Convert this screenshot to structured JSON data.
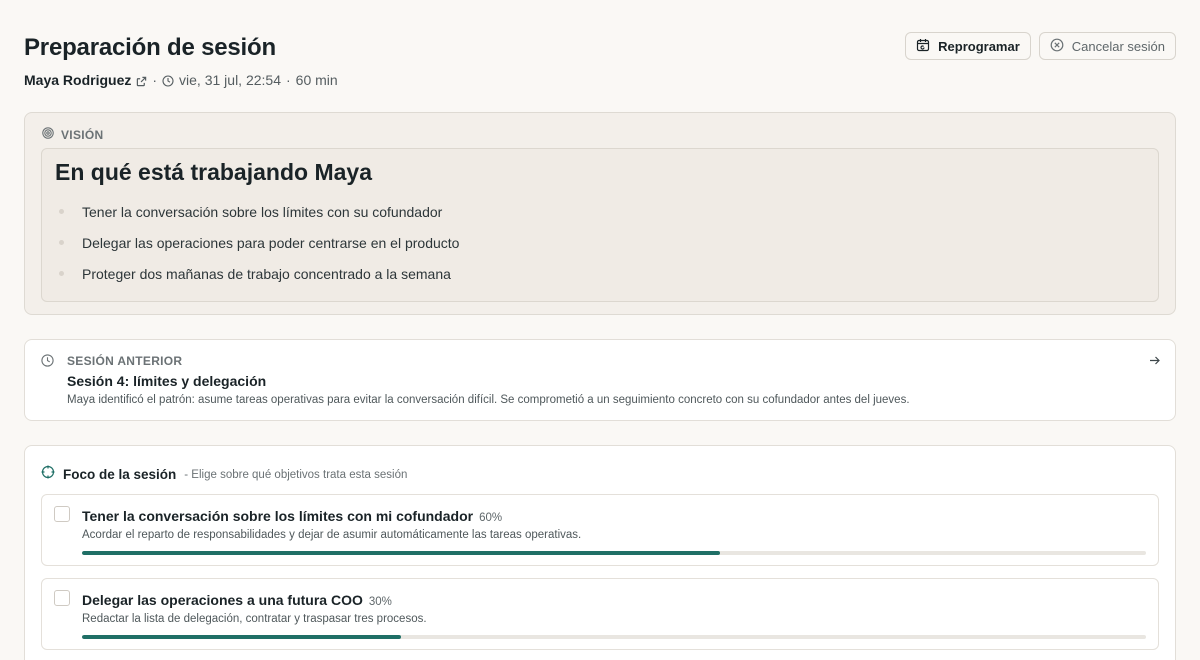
{
  "header": {
    "title": "Preparación de sesión",
    "client_name": "Maya Rodriguez",
    "separator": "·",
    "datetime": "vie, 31 jul, 22:54",
    "duration": "60 min",
    "reschedule_label": "Reprogramar",
    "cancel_label": "Cancelar sesión"
  },
  "vision": {
    "label": "VISIÓN",
    "title": "En qué está trabajando Maya",
    "items": [
      "Tener la conversación sobre los límites con su cofundador",
      "Delegar las operaciones para poder centrarse en el producto",
      "Proteger dos mañanas de trabajo concentrado a la semana"
    ]
  },
  "previous_session": {
    "label": "SESIÓN ANTERIOR",
    "title": "Sesión 4: límites y delegación",
    "summary": "Maya identificó el patrón: asume tareas operativas para evitar la conversación difícil. Se comprometió a un seguimiento concreto con su cofundador antes del jueves."
  },
  "focus": {
    "title": "Foco de la sesión",
    "subtitle": "- Elige sobre qué objetivos trata esta sesión",
    "goals": [
      {
        "title": "Tener la conversación sobre los límites con mi cofundador",
        "percent_label": "60%",
        "progress": 0.6,
        "description": "Acordar el reparto de responsabilidades y dejar de asumir automáticamente las tareas operativas."
      },
      {
        "title": "Delegar las operaciones a una futura COO",
        "percent_label": "30%",
        "progress": 0.3,
        "description": "Redactar la lista de delegación, contratar y traspasar tres procesos."
      }
    ]
  },
  "colors": {
    "accent": "#1f6f66",
    "background": "#faf8f5",
    "vision_bg": "#f3efea"
  }
}
